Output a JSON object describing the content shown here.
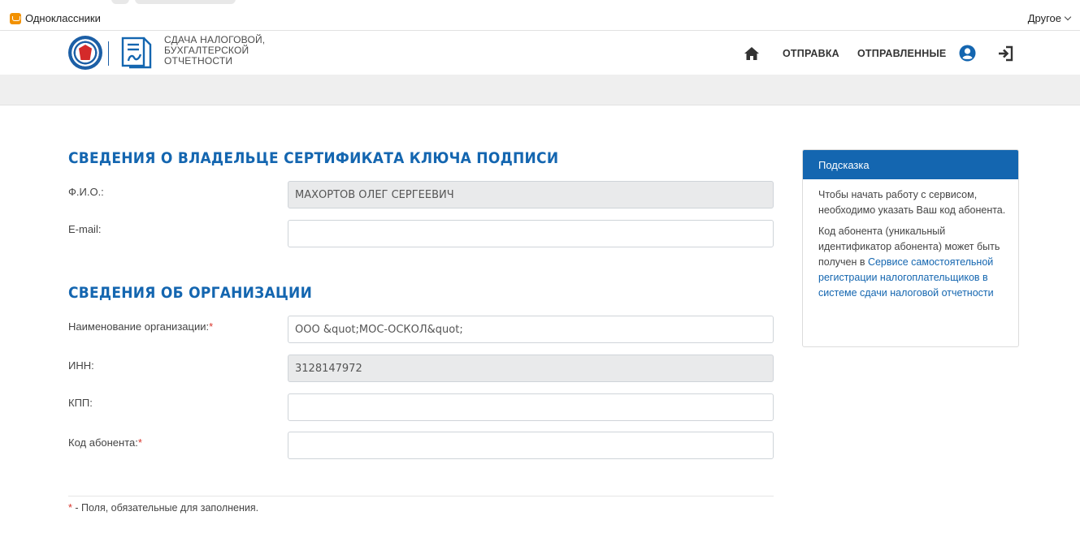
{
  "bookmarks": {
    "item_label": "Одноклассники",
    "other_label": "Другое"
  },
  "header": {
    "logo_line1": "СДАЧА НАЛОГОВОЙ,",
    "logo_line2": "БУХГАЛТЕРСКОЙ",
    "logo_line3": "ОТЧЕТНОСТИ",
    "nav_send": "ОТПРАВКА",
    "nav_sent": "ОТПРАВЛЕННЫЕ"
  },
  "owner_section": {
    "title": "СВЕДЕНИЯ О ВЛАДЕЛЬЦЕ СЕРТИФИКАТА КЛЮЧА ПОДПИСИ",
    "fio_label": "Ф.И.О.:",
    "fio_value": "МАХОРТОВ ОЛЕГ СЕРГЕЕВИЧ",
    "email_label": "E-mail:",
    "email_value": ""
  },
  "org_section": {
    "title": "СВЕДЕНИЯ ОБ ОРГАНИЗАЦИИ",
    "name_label": "Наименование организации:",
    "name_value": "ООО &quot;МОС-ОСКОЛ&quot;",
    "inn_label": "ИНН:",
    "inn_value": "3128147972",
    "kpp_label": "КПП:",
    "kpp_value": "",
    "subscriber_label": "Код абонента:",
    "subscriber_value": ""
  },
  "required_mark": "*",
  "footnote": " - Поля, обязательные для заполнения.",
  "hint": {
    "title": "Подсказка",
    "para1": "Чтобы начать работу с сервисом, необходимо указать Ваш код абонента.",
    "para2_text": "Код абонента (уникальный идентификатор абонента) может быть получен в ",
    "para2_link": "Сервисе самостоятельной регистрации налогоплательщиков в системе сдачи налоговой отчетности"
  },
  "colors": {
    "brand_blue": "#1466b0",
    "required_red": "#d9342b",
    "readonly_bg": "#e9eaeb"
  },
  "icons": [
    "home-icon",
    "user-icon",
    "logout-icon"
  ]
}
